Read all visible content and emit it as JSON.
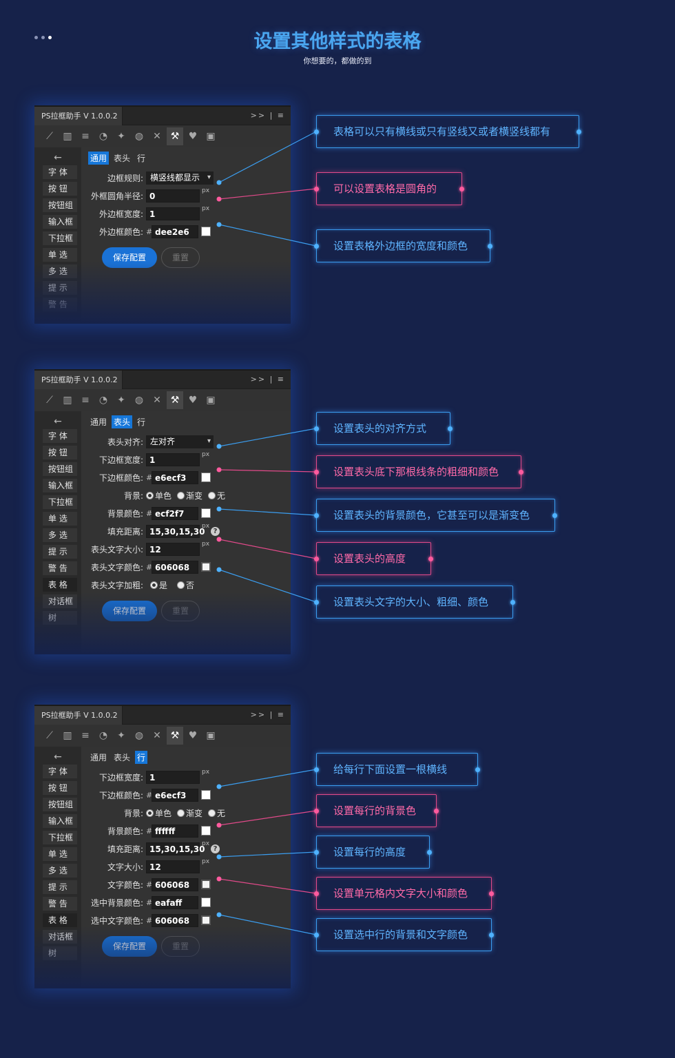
{
  "header": {
    "title": "设置其他样式的表格",
    "subtitle": "你想要的，都做的到"
  },
  "panel_common": {
    "window_title": "PS拉框助手 V 1.0.0.2",
    "window_controls": ">> | ≡",
    "save_label": "保存配置",
    "reset_label": "重置",
    "tabs": [
      "通用",
      "表头",
      "行"
    ],
    "tools": [
      "chart-line-icon",
      "chart-bar-icon",
      "align-icon",
      "pie-icon",
      "puzzle-icon",
      "globe-icon",
      "tools-icon",
      "wrench-icon",
      "heart-icon",
      "frame-icon"
    ],
    "sidebar": [
      "字  体",
      "按  钮",
      "按钮组",
      "输入框",
      "下拉框",
      "单  选",
      "多  选",
      "提  示",
      "警  告",
      "表  格",
      "对话框",
      "树"
    ]
  },
  "panel1": {
    "active_tab": 0,
    "border_rule_label": "边框规则:",
    "border_rule_value": "横竖线都显示",
    "radius_label": "外框圆角半径:",
    "radius_value": "0",
    "border_width_label": "外边框宽度:",
    "border_width_value": "1",
    "border_color_label": "外边框颜色:",
    "border_color_value": "dee2e6",
    "unit": "px"
  },
  "panel2": {
    "active_tab": 1,
    "align_label": "表头对齐:",
    "align_value": "左对齐",
    "bottom_width_label": "下边框宽度:",
    "bottom_width_value": "1",
    "bottom_color_label": "下边框颜色:",
    "bottom_color_value": "e6ecf3",
    "bg_label": "背景:",
    "bg_options": [
      "单色",
      "渐变",
      "无"
    ],
    "bg_color_label": "背景颜色:",
    "bg_color_value": "ecf2f7",
    "padding_label": "填充距离:",
    "padding_value": "15,30,15,30",
    "font_size_label": "表头文字大小:",
    "font_size_value": "12",
    "font_color_label": "表头文字颜色:",
    "font_color_value": "606068",
    "bold_label": "表头文字加粗:",
    "bold_options": [
      "是",
      "否"
    ],
    "unit": "px"
  },
  "panel3": {
    "active_tab": 2,
    "bottom_width_label": "下边框宽度:",
    "bottom_width_value": "1",
    "bottom_color_label": "下边框颜色:",
    "bottom_color_value": "e6ecf3",
    "bg_label": "背景:",
    "bg_options": [
      "单色",
      "渐变",
      "无"
    ],
    "bg_color_label": "背景颜色:",
    "bg_color_value": "ffffff",
    "padding_label": "填充距离:",
    "padding_value": "15,30,15,30",
    "font_size_label": "文字大小:",
    "font_size_value": "12",
    "font_color_label": "文字颜色:",
    "font_color_value": "606068",
    "sel_bg_label": "选中背景颜色:",
    "sel_bg_value": "eafaff",
    "sel_font_label": "选中文字颜色:",
    "sel_font_value": "606068",
    "unit": "px"
  },
  "callouts": {
    "c1": "表格可以只有横线或只有竖线又或者横竖线都有",
    "c2": "可以设置表格是圆角的",
    "c3": "设置表格外边框的宽度和颜色",
    "c4": "设置表头的对齐方式",
    "c5": "设置表头底下那根线条的粗细和颜色",
    "c6": "设置表头的背景颜色，它甚至可以是渐变色",
    "c7": "设置表头的高度",
    "c8": "设置表头文字的大小、粗细、颜色",
    "c9": "给每行下面设置一根横线",
    "c10": "设置每行的背景色",
    "c11": "设置每行的高度",
    "c12": "设置单元格内文字大小和颜色",
    "c13": "设置选中行的背景和文字颜色"
  },
  "colors": {
    "background": "#16224a",
    "blue_accent": "#3b9ef0",
    "pink_accent": "#e24a8a",
    "primary_button": "#1a72d6"
  }
}
